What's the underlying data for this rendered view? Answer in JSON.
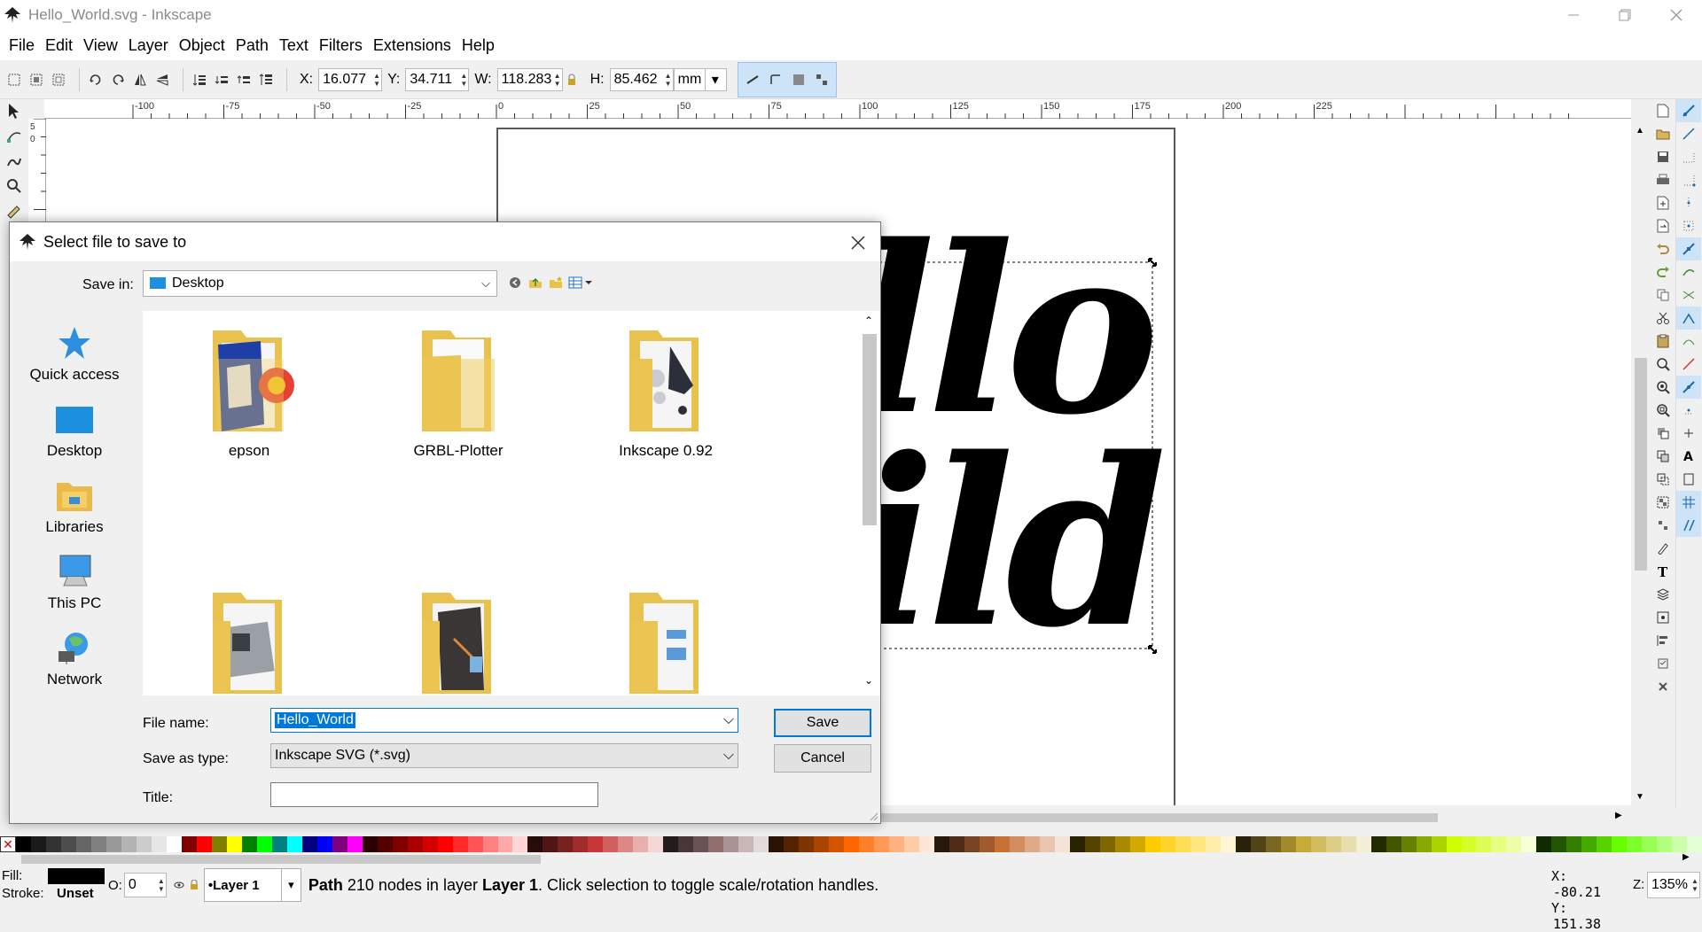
{
  "window": {
    "title": "Hello_World.svg - Inkscape",
    "minimize": "—",
    "restore": "❐",
    "close": "✕"
  },
  "menu": [
    "File",
    "Edit",
    "View",
    "Layer",
    "Object",
    "Path",
    "Text",
    "Filters",
    "Extensions",
    "Help"
  ],
  "toolbar": {
    "x_label": "X:",
    "x_value": "16.077",
    "y_label": "Y:",
    "y_value": "34.711",
    "w_label": "W:",
    "w_value": "118.283",
    "h_label": "H:",
    "h_value": "85.462",
    "unit": "mm"
  },
  "ruler": {
    "h_ticks": [
      "-100",
      "-75",
      "-50",
      "-25",
      "0",
      "25",
      "50",
      "75",
      "100",
      "125",
      "150",
      "175",
      "200",
      "225"
    ],
    "v_ticks": [
      "5",
      "0"
    ]
  },
  "canvas": {
    "text_line1": "llo",
    "text_line2": "ild"
  },
  "dialog": {
    "title": "Select file to save to",
    "save_in_label": "Save in:",
    "save_in_value": "Desktop",
    "places": [
      "Quick access",
      "Desktop",
      "Libraries",
      "This PC",
      "Network"
    ],
    "files": [
      "epson",
      "GRBL-Plotter",
      "Inkscape 0.92",
      "",
      "",
      ""
    ],
    "file_name_label": "File name:",
    "file_name_value": "Hello_World",
    "save_as_type_label": "Save as type:",
    "save_as_type_value": "Inkscape SVG (*.svg)",
    "title_label": "Title:",
    "title_value": "",
    "save_button": "Save",
    "cancel_button": "Cancel"
  },
  "status": {
    "fill_label": "Fill:",
    "stroke_label": "Stroke:",
    "stroke_value": "Unset",
    "opacity_label": "O:",
    "opacity_value": "0",
    "layer": "•Layer 1",
    "message_bold": "Path",
    "message_a": " 210 nodes in layer ",
    "message_layer": "Layer 1",
    "message_b": ". Click selection to toggle scale/rotation handles.",
    "x_label": "X:",
    "x_value": "-80.21",
    "y_label": "Y:",
    "y_value": "151.38",
    "z_label": "Z:",
    "z_value": "135%"
  },
  "palette_colors": [
    "#000000",
    "#1a1a1a",
    "#333333",
    "#4d4d4d",
    "#666666",
    "#808080",
    "#999999",
    "#b3b3b3",
    "#cccccc",
    "#e6e6e6",
    "#ffffff",
    "#800000",
    "#ff0000",
    "#808000",
    "#ffff00",
    "#008000",
    "#00ff00",
    "#008080",
    "#00ffff",
    "#000080",
    "#0000ff",
    "#800080",
    "#ff00ff",
    "#2b0000",
    "#550000",
    "#800000",
    "#aa0000",
    "#d40000",
    "#ff0000",
    "#ff2a2a",
    "#ff5555",
    "#ff8080",
    "#ffaaaa",
    "#ffd5d5",
    "#280b0b",
    "#501616",
    "#782121",
    "#a02c2c",
    "#c83737",
    "#d35f5f",
    "#de8787",
    "#e9afaf",
    "#f4d7d7",
    "#241c1c",
    "#483737",
    "#6c5353",
    "#916f6f",
    "#ac9393",
    "#c8b7b7",
    "#e3dbdb",
    "#2b1100",
    "#552200",
    "#803300",
    "#aa4400",
    "#d45500",
    "#ff6600",
    "#ff7f2a",
    "#ff9955",
    "#ffb380",
    "#ffccaa",
    "#ffe6d5",
    "#28170b",
    "#502d16",
    "#784421",
    "#a05a2c",
    "#c87137",
    "#d38d5f",
    "#deaa87",
    "#e9c6af",
    "#f4e3d7",
    "#2b2200",
    "#554400",
    "#806600",
    "#aa8800",
    "#d4aa00",
    "#ffcc00",
    "#ffd42a",
    "#ffdd55",
    "#ffe680",
    "#ffeeaa",
    "#fff6d5",
    "#28220b",
    "#504416",
    "#786721",
    "#a0892c",
    "#c8ab37",
    "#d3bc5f",
    "#decd87",
    "#e9ddaf",
    "#f4eed7",
    "#222b00",
    "#445500",
    "#668000",
    "#88aa00",
    "#aad400",
    "#ccff00",
    "#d4ff2a",
    "#ddff55",
    "#e5ff80",
    "#eeffaa",
    "#f6ffd5",
    "#112b00",
    "#225500",
    "#338000",
    "#44aa00",
    "#55d400",
    "#66ff00",
    "#7fff2a",
    "#99ff55",
    "#b3ff80",
    "#ccffaa",
    "#e5ffd5"
  ]
}
